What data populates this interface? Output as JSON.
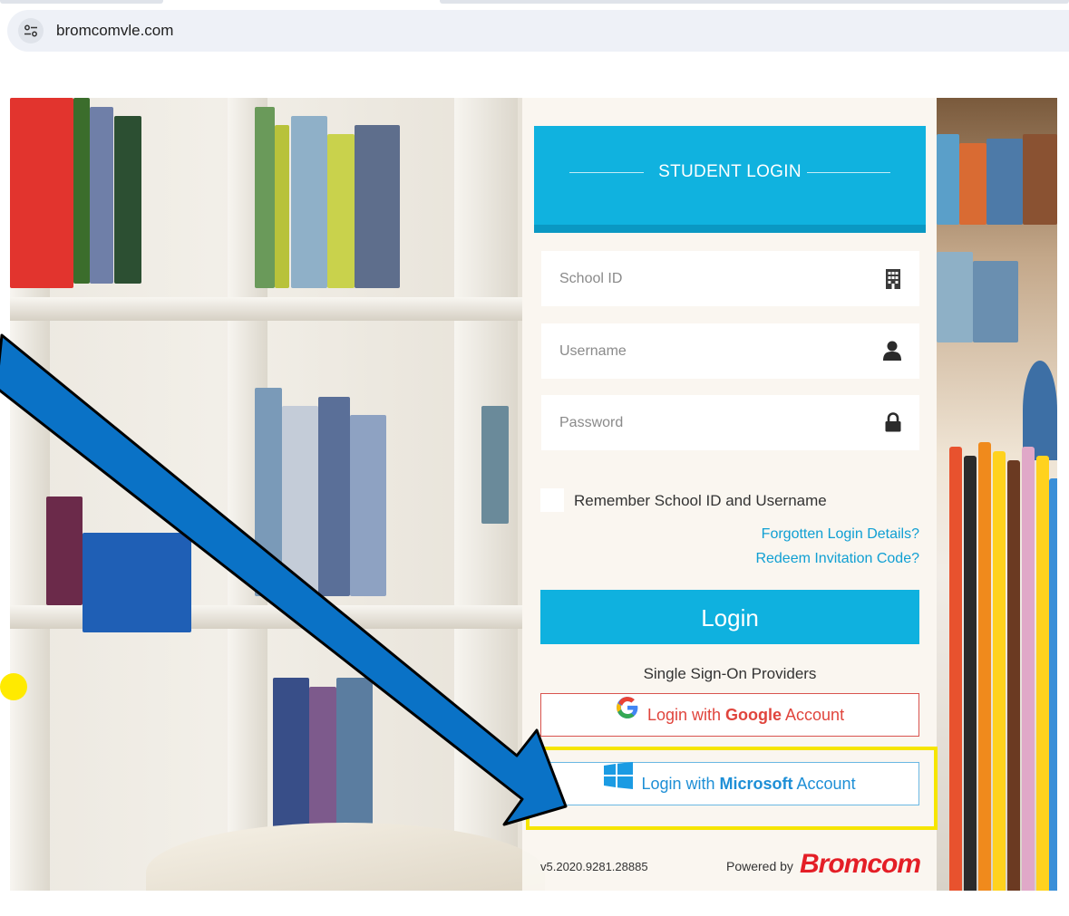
{
  "browser": {
    "url": "bromcomvle.com",
    "site_icon": "tune-icon"
  },
  "login": {
    "title": "STUDENT LOGIN",
    "school_id_placeholder": "School ID",
    "school_id_icon": "building-icon",
    "username_placeholder": "Username",
    "username_icon": "user-icon",
    "password_placeholder": "Password",
    "password_icon": "lock-icon",
    "remember_label": "Remember School ID and Username",
    "forgotten_link": "Forgotten Login Details?",
    "redeem_link": "Redeem Invitation Code?",
    "login_button": "Login",
    "sso_title": "Single Sign-On Providers",
    "google": {
      "prefix": "Login with",
      "brand": "Google",
      "suffix": "Account"
    },
    "microsoft": {
      "prefix": "Login with",
      "brand": "Microsoft",
      "suffix": "Account"
    },
    "version": "v5.2020.9281.28885",
    "powered_by": "Powered by",
    "brand_name": "Bromcom"
  },
  "colors": {
    "accent": "#0fb1df",
    "google_red": "#e0453d",
    "microsoft_blue": "#1e8fd6",
    "annotation_arrow": "#0a72c6",
    "annotation_highlight": "#f6e500",
    "brand_red": "#e41e26"
  }
}
